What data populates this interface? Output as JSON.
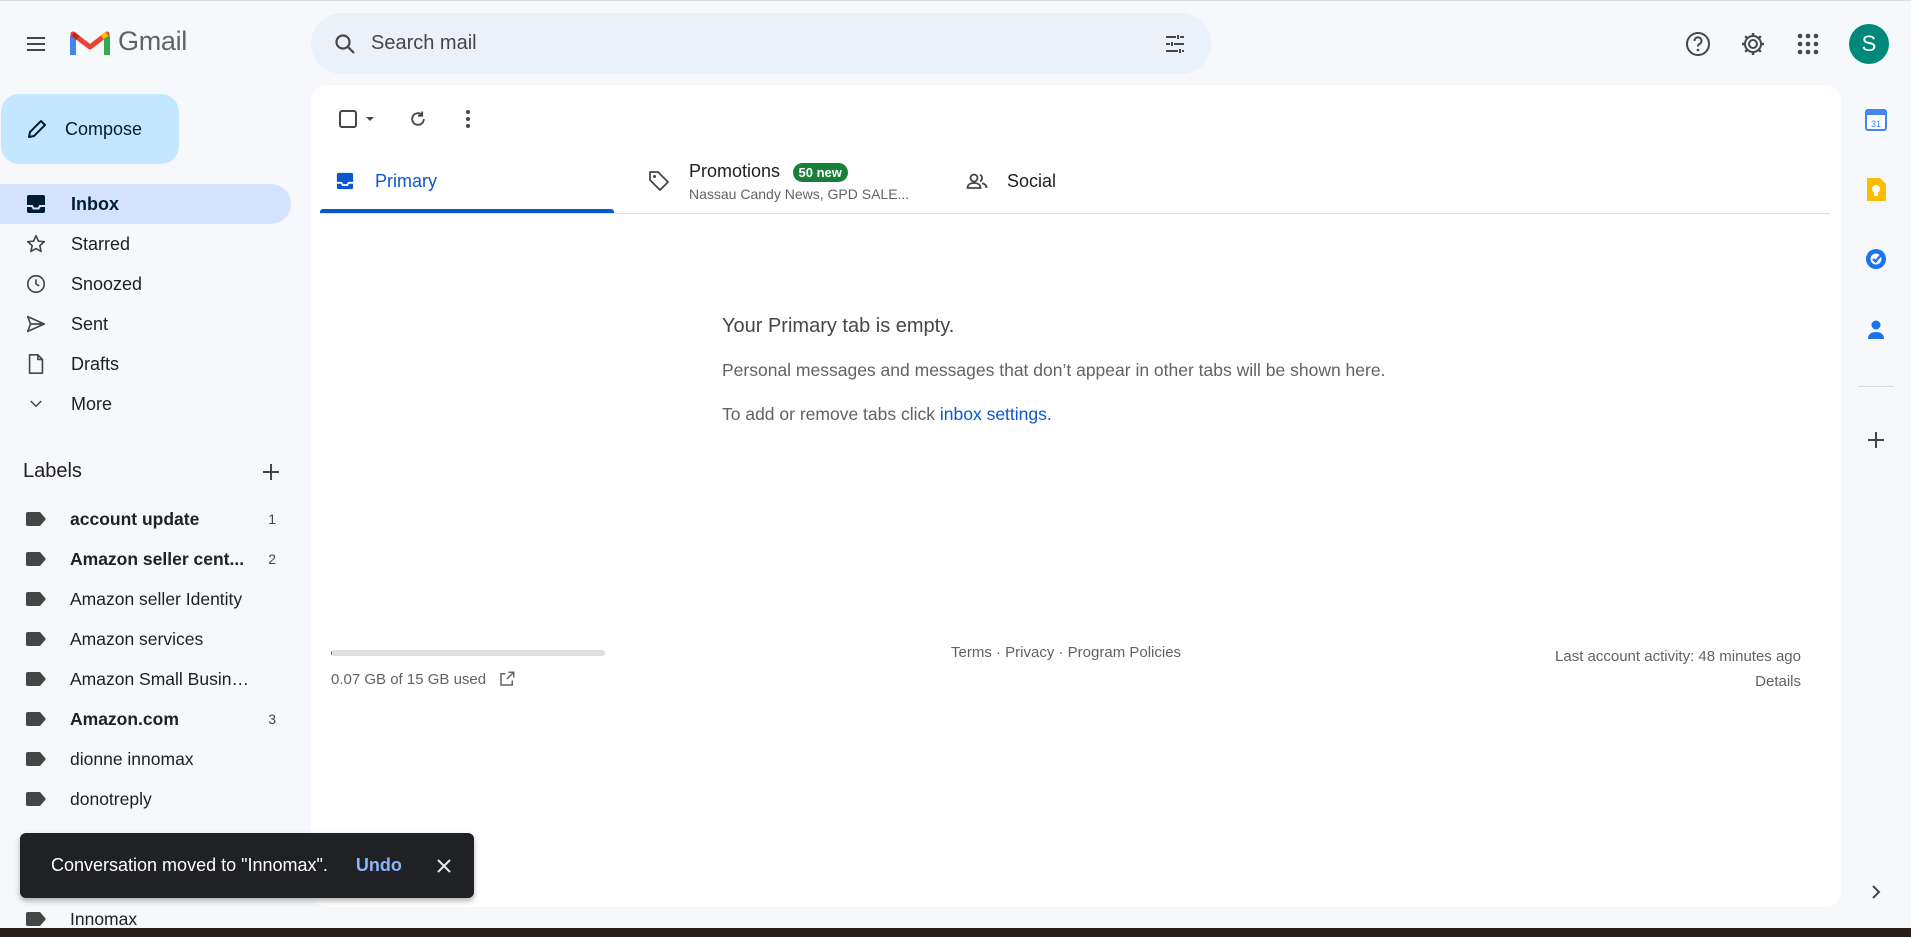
{
  "app": {
    "name": "Gmail"
  },
  "search": {
    "placeholder": "Search mail"
  },
  "account": {
    "avatar_letter": "S"
  },
  "sidebar": {
    "compose_label": "Compose",
    "items": [
      {
        "label": "Inbox",
        "icon": "inbox-icon",
        "active": true
      },
      {
        "label": "Starred",
        "icon": "star-icon"
      },
      {
        "label": "Snoozed",
        "icon": "clock-icon"
      },
      {
        "label": "Sent",
        "icon": "send-icon"
      },
      {
        "label": "Drafts",
        "icon": "draft-icon"
      },
      {
        "label": "More",
        "icon": "chevron-down-icon"
      }
    ],
    "labels_title": "Labels",
    "labels": [
      {
        "name": "account update",
        "count": "1",
        "bold": true
      },
      {
        "name": "Amazon seller cent...",
        "count": "2",
        "bold": true
      },
      {
        "name": "Amazon seller Identity",
        "count": ""
      },
      {
        "name": "Amazon services",
        "count": ""
      },
      {
        "name": "Amazon Small Business",
        "count": ""
      },
      {
        "name": "Amazon.com",
        "count": "3",
        "bold": true
      },
      {
        "name": "dionne innomax",
        "count": ""
      },
      {
        "name": "donotreply",
        "count": ""
      },
      {
        "name": "Innomax",
        "count": ""
      }
    ]
  },
  "tabs": {
    "primary": {
      "label": "Primary"
    },
    "promotions": {
      "label": "Promotions",
      "badge": "50 new",
      "subtitle": "Nassau Candy News, GPD SALE..."
    },
    "social": {
      "label": "Social"
    }
  },
  "empty_state": {
    "title": "Your Primary tab is empty.",
    "description": "Personal messages and messages that don’t appear in other tabs will be shown here.",
    "hint_prefix": "To add or remove tabs click ",
    "hint_link": "inbox settings",
    "hint_suffix": "."
  },
  "footer": {
    "storage_used": "0.07 GB of 15 GB used",
    "storage_fraction": 0.005,
    "links": "Terms · Privacy · Program Policies",
    "last_activity": "Last account activity: 48 minutes ago",
    "details": "Details"
  },
  "snackbar": {
    "message": "Conversation moved to \"Innomax\".",
    "action": "Undo"
  },
  "colors": {
    "accent": "#0b57d0",
    "compose_bg": "#c2e7ff",
    "active_nav": "#d3e3fd",
    "badge": "#188038",
    "avatar": "#00897b"
  }
}
